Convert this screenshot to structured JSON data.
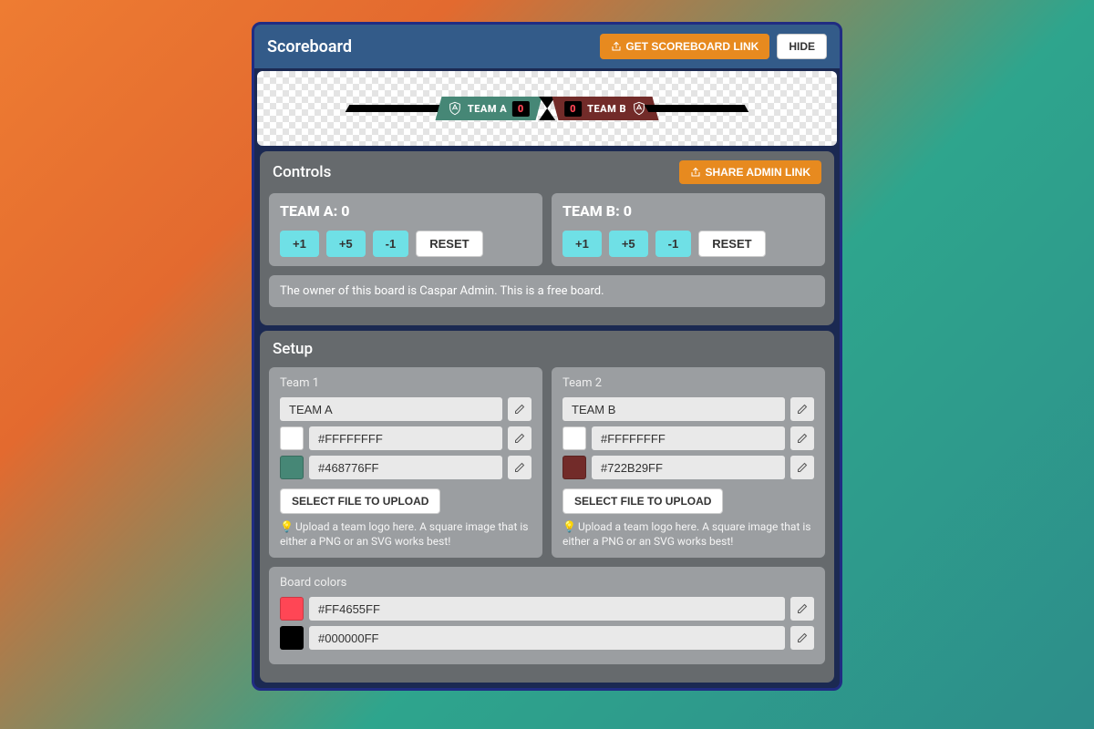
{
  "scoreboard": {
    "title": "Scoreboard",
    "get_link_label": "GET SCOREBOARD LINK",
    "hide_label": "HIDE",
    "preview": {
      "team_a_name": "TEAM A",
      "team_a_score": "0",
      "team_b_name": "TEAM B",
      "team_b_score": "0",
      "team_a_color": "#468776",
      "team_b_color": "#722b29"
    }
  },
  "controls": {
    "title": "Controls",
    "share_label": "SHARE ADMIN LINK",
    "team_a_header": "TEAM A: 0",
    "team_b_header": "TEAM B: 0",
    "buttons": {
      "plus1": "+1",
      "plus5": "+5",
      "minus1": "-1",
      "reset": "RESET"
    },
    "owner_info": "The owner of this board is Caspar Admin. This is a free board."
  },
  "setup": {
    "title": "Setup",
    "team1": {
      "label": "Team 1",
      "name": "TEAM A",
      "text_color": "#FFFFFFFF",
      "bg_color": "#468776FF",
      "bg_swatch": "#468776",
      "upload_label": "SELECT FILE TO UPLOAD",
      "hint": "Upload a team logo here. A square image that is either a PNG or an SVG works best!"
    },
    "team2": {
      "label": "Team 2",
      "name": "TEAM B",
      "text_color": "#FFFFFFFF",
      "bg_color": "#722B29FF",
      "bg_swatch": "#722b29",
      "upload_label": "SELECT FILE TO UPLOAD",
      "hint": "Upload a team logo here. A square image that is either a PNG or an SVG works best!"
    },
    "board_colors": {
      "label": "Board colors",
      "accent": "#FF4655FF",
      "accent_swatch": "#ff4655",
      "base": "#000000FF",
      "base_swatch": "#000000"
    }
  }
}
